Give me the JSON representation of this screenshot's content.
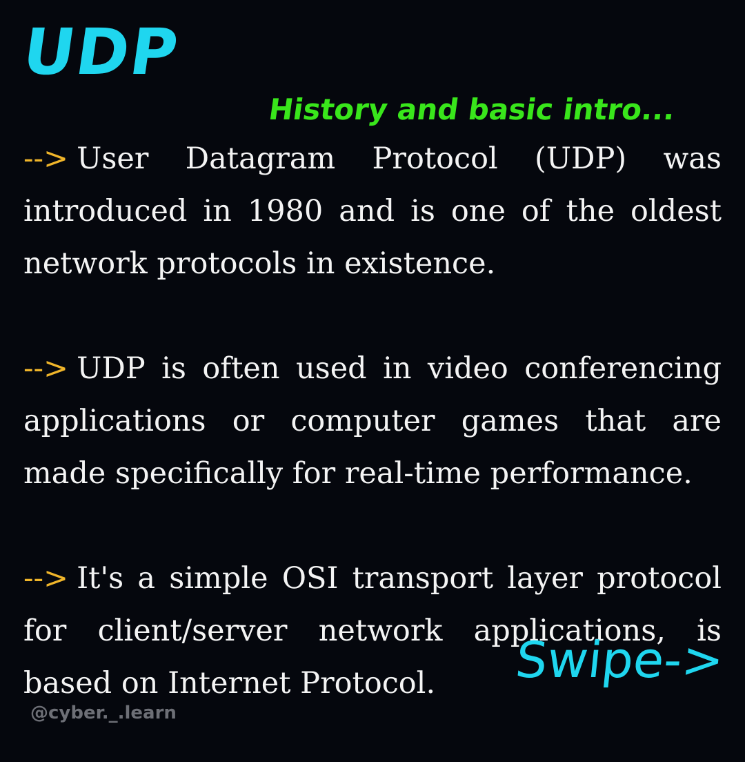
{
  "title": "UDP",
  "subtitle": "History and basic intro...",
  "paragraphs": [
    {
      "marker": "-->",
      "text": "User Datagram Protocol (UDP) was introduced in 1980 and is one of the oldest network protocols in existence."
    },
    {
      "marker": "-->",
      "text": "UDP is often used in video conferencing applications or computer games that are made specifically for real-time performance."
    },
    {
      "marker": "-->",
      "text": "It's a simple OSI transport layer protocol for client/server network applications, is based on Internet Protocol."
    }
  ],
  "swipe_label": "Swipe->",
  "handle": "@cyber._.learn",
  "colors": {
    "background": "#05070d",
    "title": "#1fd6ef",
    "subtitle": "#39e61b",
    "marker": "#f0b52a",
    "body_text": "#f4f4f4",
    "handle": "#6d6f76"
  }
}
